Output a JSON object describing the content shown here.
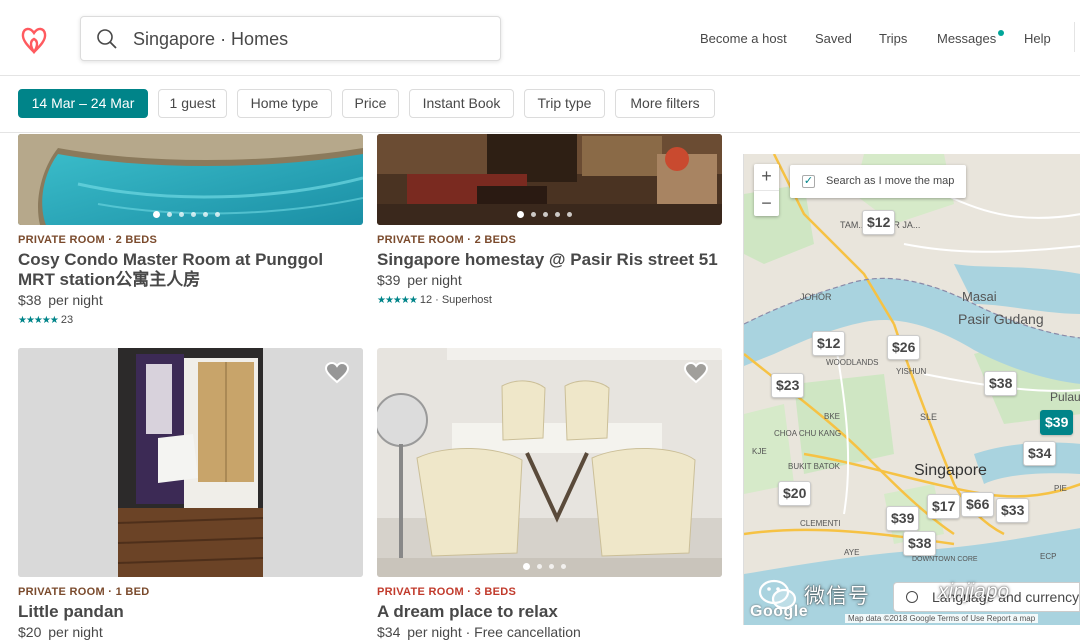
{
  "header": {
    "search_text": "Singapore · Homes",
    "nav": [
      "Become a host",
      "Saved",
      "Trips",
      "Messages",
      "Help"
    ]
  },
  "filters": [
    "14 Mar – 24 Mar",
    "1 guest",
    "Home type",
    "Price",
    "Instant Book",
    "Trip type",
    "More filters"
  ],
  "listings": [
    {
      "kind": "PRIVATE ROOM · 2 BEDS",
      "title": "Cosy Condo Master Room at Punggol MRT station公寓主人房",
      "price": "$38",
      "per": "per night",
      "stars": "★★★★★",
      "rating_text": "23"
    },
    {
      "kind": "PRIVATE ROOM · 2 BEDS",
      "title": "Singapore homestay @ Pasir Ris street 51",
      "price": "$39",
      "per": "per night",
      "stars": "★★★★★",
      "rating_text": "12 · Superhost"
    },
    {
      "kind": "PRIVATE ROOM · 1 BED",
      "title": "Little pandan",
      "price": "$20",
      "per": "per night"
    },
    {
      "kind": "PRIVATE ROOM · 3 BEDS",
      "title": "A dream place to relax",
      "price": "$34",
      "per": "per night · Free cancellation"
    }
  ],
  "map": {
    "zoom_in": "+",
    "zoom_out": "−",
    "search_checkbox_label": "Search as I move the map",
    "labels": {
      "masai": "Masai",
      "pasir_gudang": "Pasir Gudang",
      "singapore": "Singapore",
      "pulau": "Pulau",
      "johor": "JOHOR",
      "tampoi": "TAM... JOHOR JA...",
      "yishun": "YISHUN",
      "woodlands": "WOODLANDS",
      "choa_chu_kang": "CHOA CHU KANG",
      "bukit_batok": "BUKIT BATOK",
      "clementi": "CLEMENTI",
      "downtown_core": "DOWNTOWN CORE",
      "sle": "SLE",
      "kje": "KJE",
      "pie": "PIE",
      "ecp": "ECP",
      "ayer": "AYE",
      "bke": "BKE"
    },
    "pins": [
      "$12",
      "$12",
      "$26",
      "$23",
      "$38",
      "$39",
      "$34",
      "$20",
      "$17",
      "$66",
      "$33",
      "$39",
      "$38"
    ],
    "selected_pin": "$39",
    "footer": "Map data ©2018 Google    Terms of Use    Report a map",
    "google": "Google"
  },
  "language_button": "Language and currency",
  "watermark": {
    "text": "微信号",
    "url": "xinjiapo"
  },
  "colors": {
    "brand": "#ff5a5f",
    "accent": "#008489"
  }
}
